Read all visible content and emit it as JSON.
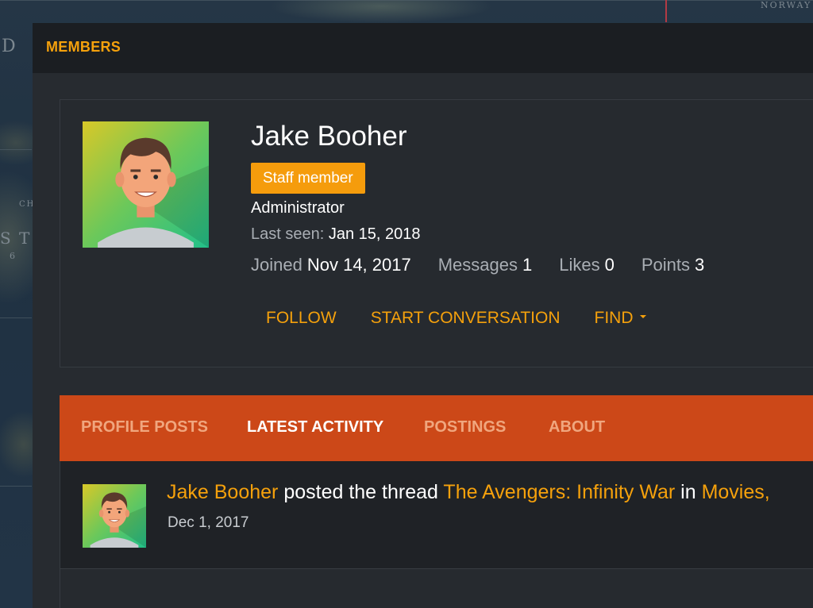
{
  "background": {
    "map_labels": [
      "D",
      "NORWAY",
      "CH",
      "S T",
      "6"
    ]
  },
  "window": {
    "title": "MEMBERS"
  },
  "profile": {
    "name": "Jake Booher",
    "badge": "Staff member",
    "role": "Administrator",
    "last_seen_label": "Last seen:",
    "last_seen_value": "Jan 15, 2018",
    "stats": [
      {
        "label": "Joined",
        "value": "Nov 14, 2017"
      },
      {
        "label": "Messages",
        "value": "1"
      },
      {
        "label": "Likes",
        "value": "0"
      },
      {
        "label": "Points",
        "value": "3"
      }
    ],
    "actions": {
      "follow": "FOLLOW",
      "start_conversation": "START CONVERSATION",
      "find": "FIND"
    }
  },
  "tabs": [
    {
      "label": "PROFILE POSTS",
      "active": false
    },
    {
      "label": "LATEST ACTIVITY",
      "active": true
    },
    {
      "label": "POSTINGS",
      "active": false
    },
    {
      "label": "ABOUT",
      "active": false
    }
  ],
  "activity": {
    "user": "Jake Booher",
    "verb": " posted the thread ",
    "thread": "The Avengers: Infinity War",
    "in_text": " in ",
    "forum": "Movies,",
    "date": "Dec 1, 2017"
  },
  "colors": {
    "accent": "#f5a10c",
    "tab_bar": "#cc4818",
    "header_bg": "#1b1e22",
    "panel_bg": "#272b30"
  },
  "icons": {
    "find_dropdown": "chevron-down-icon"
  }
}
